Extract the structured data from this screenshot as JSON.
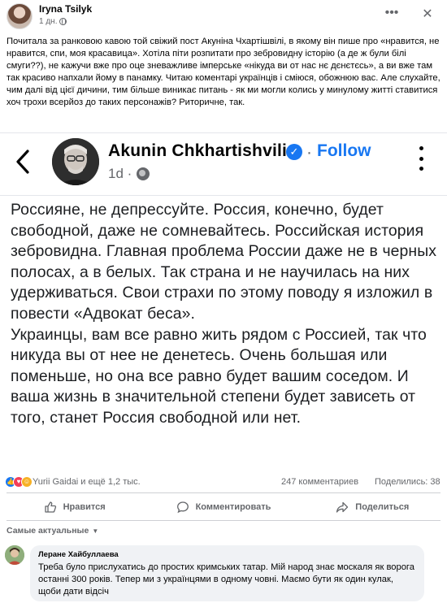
{
  "post": {
    "author": "Iryna Tsilyk",
    "time": "1 дн.",
    "text": "Почитала за ранковою кавою той свіжий пост Акуніна Чхартішвілі, в якому він пише про «нравится, не нравится, спи, моя красавица». Хотіла піти розпитати про зебровидну історію (а де ж були білі смуги??), не кажучи вже про оце зневажливе імперське «нікуда ви от нас нє дєнєтєсь», а ви вже там так красиво напхали йому в панамку. Читаю коментарі українців і сміюся, обожнюю вас. Але слухайте, чим далі від цієї дичини, тим більше виникає питань - як ми могли колись у минулому житті ставитися хоч трохи всерйоз до таких персонажів? Риторичне, так.",
    "more_icon": "ellipsis-icon",
    "close_icon": "close-icon"
  },
  "embed": {
    "name": "Akunin Chkhartishvili",
    "separator": "·",
    "follow": "Follow",
    "time": "1d ·",
    "text": "Россияне, не депрессуйте. Россия, конечно, будет свободной, даже не сомневайтесь. Российская история зебровидна. Главная проблема России даже не в черных полосах, а в белых. Так страна и не научилась на них удерживаться. Свои страхи по этому поводу я изложил в повести «Адвокат беса».\nУкраинцы, вам все равно жить рядом с Россией, так что никуда вы от нее не денетесь. Очень большая или поменьше, но она все равно будет вашим соседом. И ваша жизнь в значительной степени будет зависеть от того, станет Россия свободной или нет."
  },
  "reactions": {
    "names": "Yurii Gaidai и ещё 1,2 тыс.",
    "comments": "247 комментариев",
    "shares": "Поделились: 38"
  },
  "actions": {
    "like": "Нравится",
    "comment": "Комментировать",
    "share": "Поделиться"
  },
  "sort_label": "Самые актуальные",
  "comment": {
    "author": "Леране Хайбуллаева",
    "text": "Треба було прислухатись до простих кримських татар. Мій народ знає москаля як ворога останні 300 років. Тепер ми з українцями в одному човні. Маємо бути як один кулак, щоби дати відсіч"
  },
  "colors": {
    "accent": "#1877f2",
    "secondary_text": "#65676b",
    "bubble": "#f0f2f5"
  }
}
